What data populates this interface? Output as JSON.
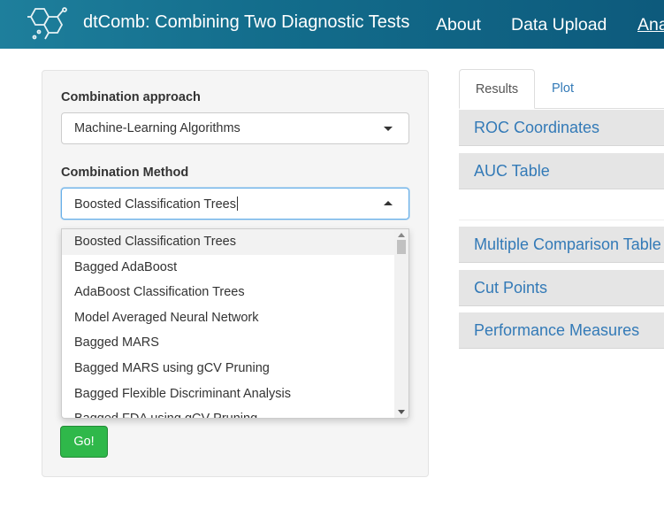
{
  "navbar": {
    "brand": "dtComb: Combining Two Diagnostic Tests",
    "logo_icon": "molecule-logo-icon",
    "items": [
      "About",
      "Data Upload",
      "Analysis"
    ]
  },
  "sidebar": {
    "approach_label": "Combination approach",
    "approach_value": "Machine-Learning Algorithms",
    "method_label": "Combination Method",
    "method_value": "Boosted Classification Trees",
    "method_options": [
      "Boosted Classification Trees",
      "Bagged AdaBoost",
      "AdaBoost Classification Trees",
      "Model Averaged Neural Network",
      "Bagged MARS",
      "Bagged MARS using gCV Pruning",
      "Bagged Flexible Discriminant Analysis",
      "Bagged FDA using gCV Pruning"
    ],
    "go_label": "Go!"
  },
  "tabs": [
    "Results",
    "Plot"
  ],
  "panels": [
    "ROC Coordinates",
    "AUC Table",
    "Multiple Comparison Table",
    "Cut Points",
    "Performance Measures"
  ],
  "colors": {
    "navbar": "#136d8c",
    "link": "#337ab7",
    "go_button": "#2fb84a"
  }
}
